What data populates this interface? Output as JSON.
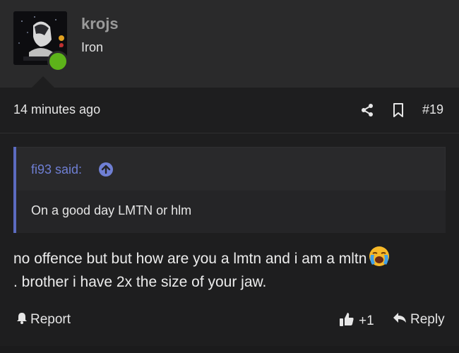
{
  "user": {
    "name": "krojs",
    "title": "Iron",
    "avatar_icon": "avatar-photo",
    "online_color": "#5db31a"
  },
  "post": {
    "time": "14 minutes ago",
    "number": "#19",
    "share_icon": "share-icon",
    "bookmark_icon": "bookmark-icon"
  },
  "quote": {
    "author": "fi93 said:",
    "text": "On a good day LMTN or hlm",
    "accent": "#5c6bc0"
  },
  "body": {
    "line1": "no offence but but how are you a lmtn and i am a mltn",
    "line2": ". brother i have 2x the size of your jaw.",
    "emoji": "loudly-crying-face"
  },
  "actions": {
    "report": "Report",
    "like_count": "+1",
    "reply": "Reply"
  }
}
